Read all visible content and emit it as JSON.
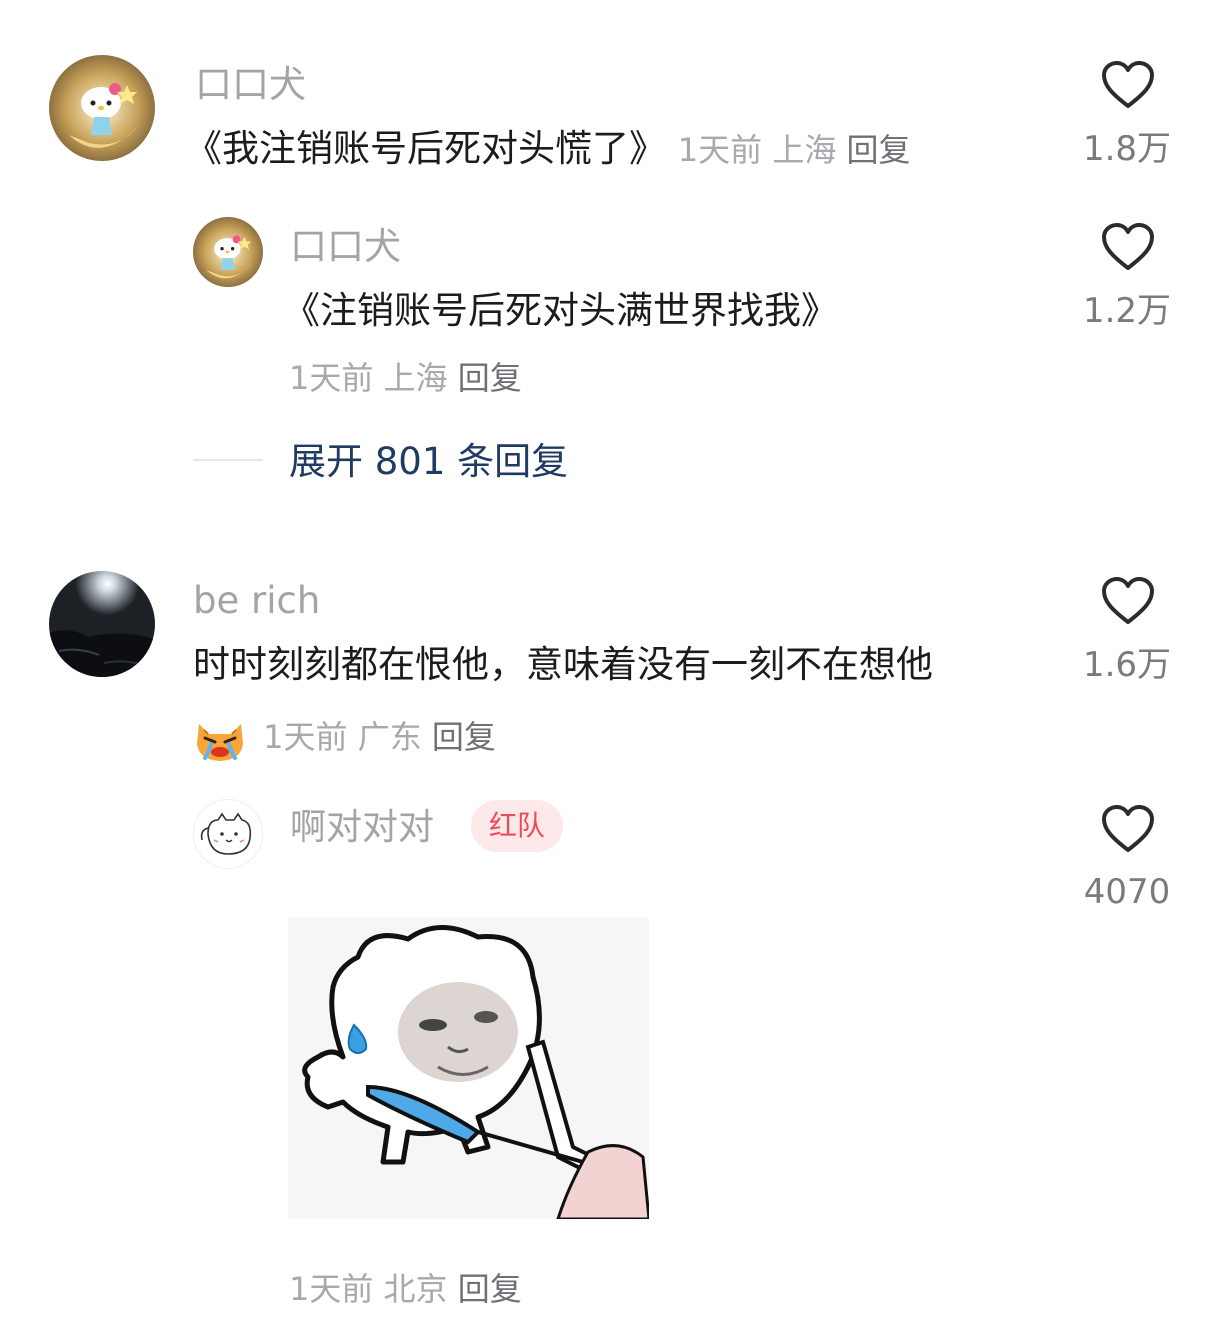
{
  "comments": [
    {
      "username": "口口犬",
      "text": "《我注销账号后死对头慌了》",
      "time": "1天前",
      "location": "上海",
      "reply_label": "回复",
      "likes": "1.8万",
      "reply": {
        "username": "口口犬",
        "text": "《注销账号后死对头满世界找我》",
        "time": "1天前",
        "location": "上海",
        "reply_label": "回复",
        "likes": "1.2万"
      },
      "expand_label": "展开 801 条回复"
    },
    {
      "username": "be rich",
      "text": "时时刻刻都在恨他，意味着没有一刻不在想他",
      "emoji_icon": "crying-cat-emoji-icon",
      "time": "1天前",
      "location": "广东",
      "reply_label": "回复",
      "likes": "1.6万",
      "reply": {
        "username": "啊对对对",
        "badge": "红队",
        "time": "1天前",
        "location": "北京",
        "reply_label": "回复",
        "likes": "4070",
        "sticker_icon": "meme-sticker-image"
      }
    }
  ],
  "colors": {
    "username": "#a3a3a8",
    "text": "#1c1c1f",
    "meta": "#a8a8ad",
    "expand": "#1f3b63",
    "badge_bg": "#fde8ea",
    "badge_text": "#ef4a58"
  }
}
